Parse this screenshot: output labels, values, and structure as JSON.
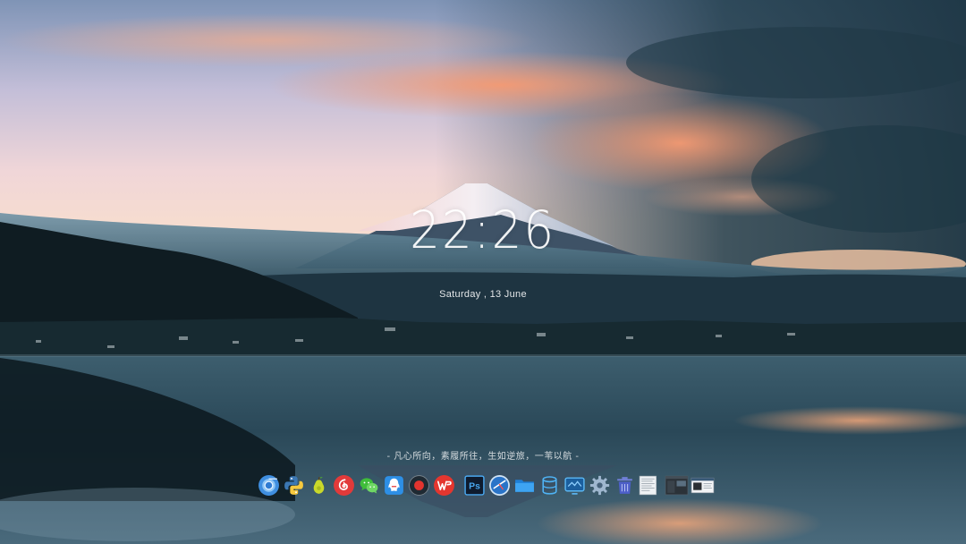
{
  "clock": {
    "time": "22:26",
    "date": "Saturday , 13 June"
  },
  "quote": "- 凡心所向，素履所往，生如逆旅，一苇以航 -",
  "photoshop_icon_label": "Ps",
  "dock": {
    "items": [
      {
        "name": "chrome",
        "icon": "chrome-icon"
      },
      {
        "name": "python",
        "icon": "python-icon"
      },
      {
        "name": "pear",
        "icon": "pear-icon"
      },
      {
        "name": "netease-music",
        "icon": "netease-music-icon"
      },
      {
        "name": "wechat",
        "icon": "wechat-icon"
      },
      {
        "name": "qq",
        "icon": "qq-icon"
      },
      {
        "name": "record",
        "icon": "record-icon"
      },
      {
        "name": "wps",
        "icon": "wps-icon"
      },
      {
        "name": "photoshop",
        "icon": "photoshop-icon"
      },
      {
        "name": "browser",
        "icon": "globe-icon"
      },
      {
        "name": "folder",
        "icon": "folder-icon"
      },
      {
        "name": "database",
        "icon": "database-icon"
      },
      {
        "name": "screen",
        "icon": "monitor-icon"
      },
      {
        "name": "settings",
        "icon": "gear-icon"
      },
      {
        "name": "trash",
        "icon": "trash-icon"
      },
      {
        "name": "document-window",
        "icon": "document-window-icon"
      },
      {
        "name": "dark-window",
        "icon": "dark-window-icon"
      },
      {
        "name": "terminal-window",
        "icon": "terminal-window-icon"
      }
    ]
  },
  "colors": {
    "sky_top": "#8a9bb8",
    "sunset_cloud": "#f2a27a",
    "dusk_cloud": "#2c4a57",
    "lake": "#223a48",
    "mountain_snow": "#e9e4ee"
  }
}
